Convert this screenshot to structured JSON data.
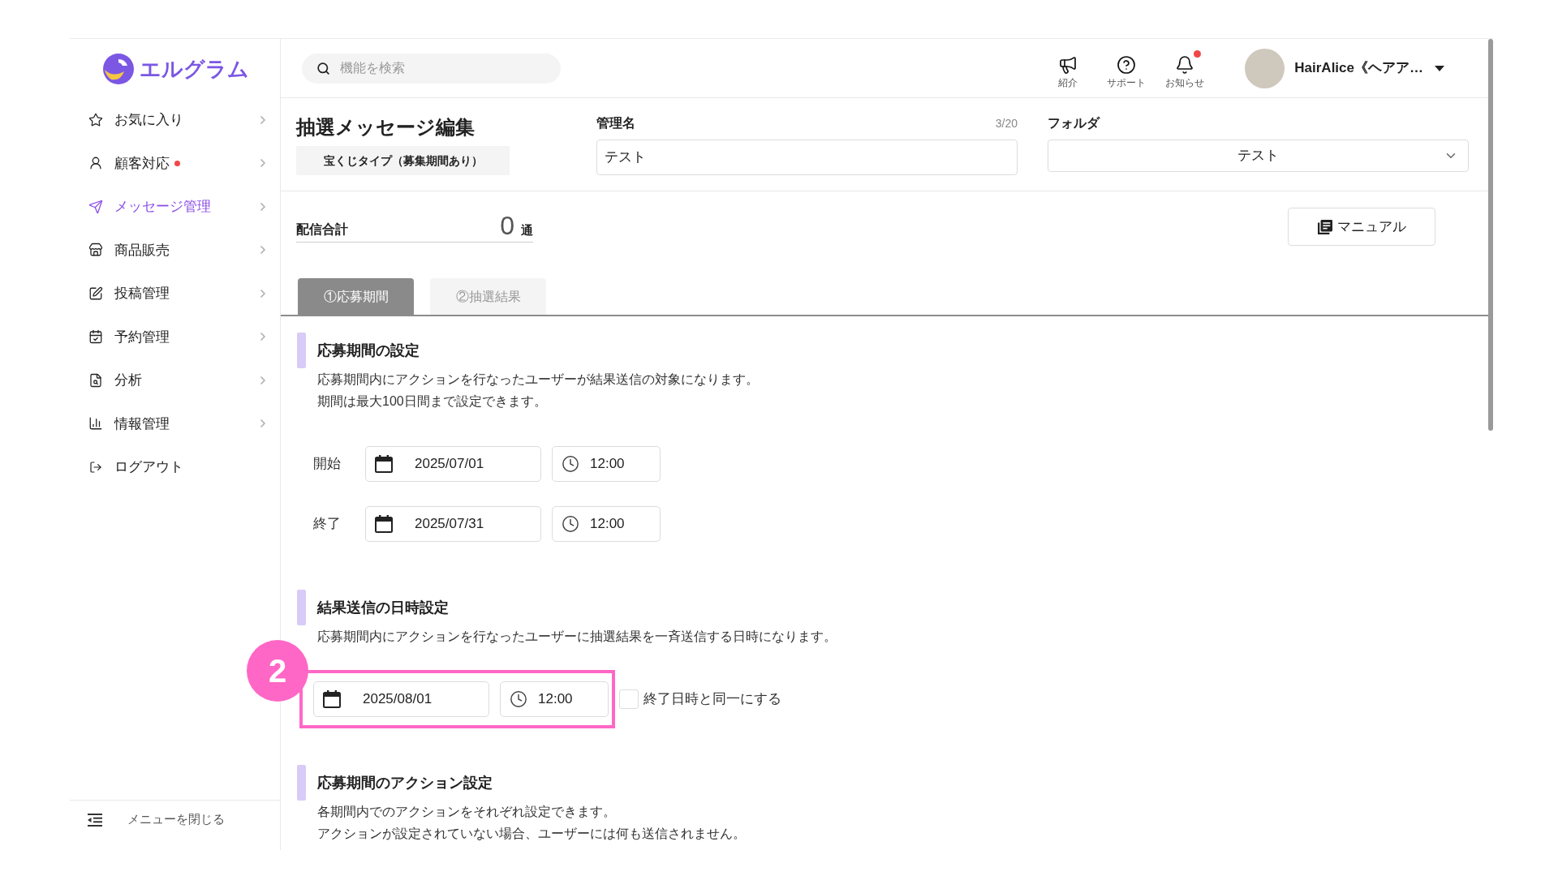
{
  "sidebar": {
    "logo": "エルグラム",
    "items": [
      {
        "label": "お気に入り",
        "kind": "menu",
        "selected": false,
        "badge": false
      },
      {
        "label": "顧客対応",
        "kind": "menu",
        "selected": false,
        "badge": true
      },
      {
        "label": "メッセージ管理",
        "kind": "menu",
        "selected": true,
        "badge": false
      },
      {
        "label": "商品販売",
        "kind": "menu",
        "selected": false,
        "badge": false
      },
      {
        "label": "投稿管理",
        "kind": "menu",
        "selected": false,
        "badge": false
      },
      {
        "label": "予約管理",
        "kind": "menu",
        "selected": false,
        "badge": false
      },
      {
        "label": "分析",
        "kind": "menu",
        "selected": false,
        "badge": false
      },
      {
        "label": "情報管理",
        "kind": "menu",
        "selected": false,
        "badge": false
      },
      {
        "label": "ログアウト",
        "kind": "action",
        "selected": false,
        "badge": false
      }
    ],
    "collapse": "メニューを閉じる"
  },
  "header": {
    "search": {
      "placeholder": "機能を検索"
    },
    "actions": [
      {
        "label": "紹介",
        "badge": false
      },
      {
        "label": "サポート",
        "badge": false
      },
      {
        "label": "お知らせ",
        "badge": true
      }
    ],
    "user": {
      "name": "HairAlice《ヘアア…"
    }
  },
  "editor": {
    "title": "抽選メッセージ編集",
    "type_label": "宝くじタイプ（募集期間あり）",
    "name_field": {
      "label": "管理名",
      "counter": "3/20",
      "value": "テスト"
    },
    "folder_field": {
      "label": "フォルダ",
      "value": "テスト"
    },
    "total": {
      "label": "配信合計",
      "value": "0",
      "unit": "通"
    },
    "manual_button": "マニュアル",
    "tabs": [
      {
        "label": "①応募期間",
        "selected": true
      },
      {
        "label": "②抽選結果",
        "selected": false
      }
    ],
    "sections": [
      {
        "title": "応募期間の設定",
        "description": [
          "応募期間内にアクションを行なったユーザーが結果送信の対象になります。",
          "期間は最大100日間まで設定できます。"
        ],
        "rows": [
          {
            "label": "開始",
            "date": "2025/07/01",
            "time": "12:00"
          },
          {
            "label": "終了",
            "date": "2025/07/31",
            "time": "12:00"
          }
        ]
      },
      {
        "title": "結果送信の日時設定",
        "description": [
          "応募期間内にアクションを行なったユーザーに抽選結果を一斉送信する日時になります。"
        ],
        "rows": [
          {
            "date": "2025/08/01",
            "time": "12:00",
            "checkbox": {
              "label": "終了日時と同一にする",
              "checked": false
            },
            "highlight": {
              "label": "2"
            }
          }
        ]
      },
      {
        "title": "応募期間のアクション設定",
        "description": [
          "各期間内でのアクションをそれぞれ設定できます。",
          "アクションが設定されていない場合、ユーザーには何も送信されません。"
        ]
      }
    ]
  }
}
